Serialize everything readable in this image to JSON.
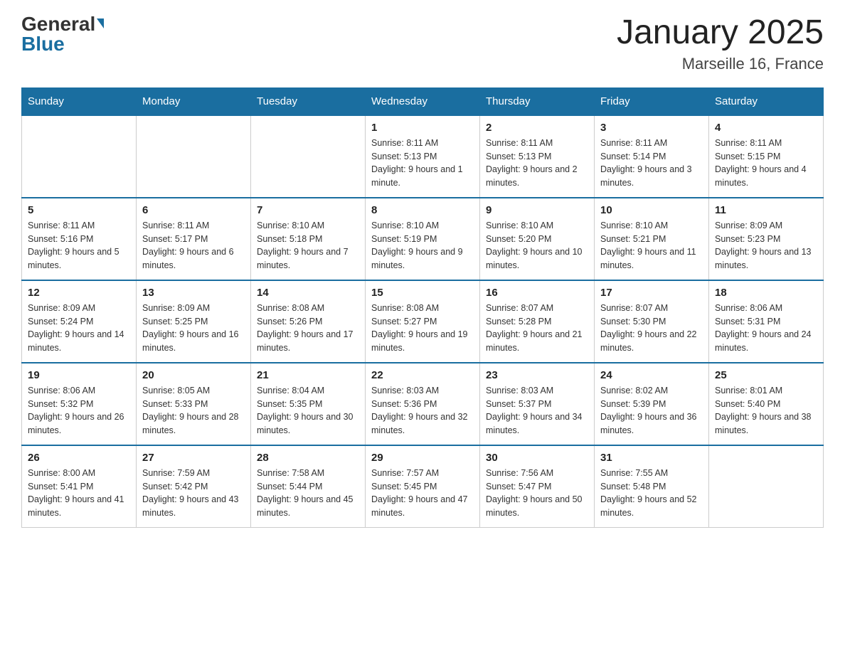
{
  "header": {
    "logo_general": "General",
    "logo_blue": "Blue",
    "month_title": "January 2025",
    "location": "Marseille 16, France"
  },
  "days_of_week": [
    "Sunday",
    "Monday",
    "Tuesday",
    "Wednesday",
    "Thursday",
    "Friday",
    "Saturday"
  ],
  "weeks": [
    [
      {
        "day": "",
        "info": ""
      },
      {
        "day": "",
        "info": ""
      },
      {
        "day": "",
        "info": ""
      },
      {
        "day": "1",
        "info": "Sunrise: 8:11 AM\nSunset: 5:13 PM\nDaylight: 9 hours and 1 minute."
      },
      {
        "day": "2",
        "info": "Sunrise: 8:11 AM\nSunset: 5:13 PM\nDaylight: 9 hours and 2 minutes."
      },
      {
        "day": "3",
        "info": "Sunrise: 8:11 AM\nSunset: 5:14 PM\nDaylight: 9 hours and 3 minutes."
      },
      {
        "day": "4",
        "info": "Sunrise: 8:11 AM\nSunset: 5:15 PM\nDaylight: 9 hours and 4 minutes."
      }
    ],
    [
      {
        "day": "5",
        "info": "Sunrise: 8:11 AM\nSunset: 5:16 PM\nDaylight: 9 hours and 5 minutes."
      },
      {
        "day": "6",
        "info": "Sunrise: 8:11 AM\nSunset: 5:17 PM\nDaylight: 9 hours and 6 minutes."
      },
      {
        "day": "7",
        "info": "Sunrise: 8:10 AM\nSunset: 5:18 PM\nDaylight: 9 hours and 7 minutes."
      },
      {
        "day": "8",
        "info": "Sunrise: 8:10 AM\nSunset: 5:19 PM\nDaylight: 9 hours and 9 minutes."
      },
      {
        "day": "9",
        "info": "Sunrise: 8:10 AM\nSunset: 5:20 PM\nDaylight: 9 hours and 10 minutes."
      },
      {
        "day": "10",
        "info": "Sunrise: 8:10 AM\nSunset: 5:21 PM\nDaylight: 9 hours and 11 minutes."
      },
      {
        "day": "11",
        "info": "Sunrise: 8:09 AM\nSunset: 5:23 PM\nDaylight: 9 hours and 13 minutes."
      }
    ],
    [
      {
        "day": "12",
        "info": "Sunrise: 8:09 AM\nSunset: 5:24 PM\nDaylight: 9 hours and 14 minutes."
      },
      {
        "day": "13",
        "info": "Sunrise: 8:09 AM\nSunset: 5:25 PM\nDaylight: 9 hours and 16 minutes."
      },
      {
        "day": "14",
        "info": "Sunrise: 8:08 AM\nSunset: 5:26 PM\nDaylight: 9 hours and 17 minutes."
      },
      {
        "day": "15",
        "info": "Sunrise: 8:08 AM\nSunset: 5:27 PM\nDaylight: 9 hours and 19 minutes."
      },
      {
        "day": "16",
        "info": "Sunrise: 8:07 AM\nSunset: 5:28 PM\nDaylight: 9 hours and 21 minutes."
      },
      {
        "day": "17",
        "info": "Sunrise: 8:07 AM\nSunset: 5:30 PM\nDaylight: 9 hours and 22 minutes."
      },
      {
        "day": "18",
        "info": "Sunrise: 8:06 AM\nSunset: 5:31 PM\nDaylight: 9 hours and 24 minutes."
      }
    ],
    [
      {
        "day": "19",
        "info": "Sunrise: 8:06 AM\nSunset: 5:32 PM\nDaylight: 9 hours and 26 minutes."
      },
      {
        "day": "20",
        "info": "Sunrise: 8:05 AM\nSunset: 5:33 PM\nDaylight: 9 hours and 28 minutes."
      },
      {
        "day": "21",
        "info": "Sunrise: 8:04 AM\nSunset: 5:35 PM\nDaylight: 9 hours and 30 minutes."
      },
      {
        "day": "22",
        "info": "Sunrise: 8:03 AM\nSunset: 5:36 PM\nDaylight: 9 hours and 32 minutes."
      },
      {
        "day": "23",
        "info": "Sunrise: 8:03 AM\nSunset: 5:37 PM\nDaylight: 9 hours and 34 minutes."
      },
      {
        "day": "24",
        "info": "Sunrise: 8:02 AM\nSunset: 5:39 PM\nDaylight: 9 hours and 36 minutes."
      },
      {
        "day": "25",
        "info": "Sunrise: 8:01 AM\nSunset: 5:40 PM\nDaylight: 9 hours and 38 minutes."
      }
    ],
    [
      {
        "day": "26",
        "info": "Sunrise: 8:00 AM\nSunset: 5:41 PM\nDaylight: 9 hours and 41 minutes."
      },
      {
        "day": "27",
        "info": "Sunrise: 7:59 AM\nSunset: 5:42 PM\nDaylight: 9 hours and 43 minutes."
      },
      {
        "day": "28",
        "info": "Sunrise: 7:58 AM\nSunset: 5:44 PM\nDaylight: 9 hours and 45 minutes."
      },
      {
        "day": "29",
        "info": "Sunrise: 7:57 AM\nSunset: 5:45 PM\nDaylight: 9 hours and 47 minutes."
      },
      {
        "day": "30",
        "info": "Sunrise: 7:56 AM\nSunset: 5:47 PM\nDaylight: 9 hours and 50 minutes."
      },
      {
        "day": "31",
        "info": "Sunrise: 7:55 AM\nSunset: 5:48 PM\nDaylight: 9 hours and 52 minutes."
      },
      {
        "day": "",
        "info": ""
      }
    ]
  ]
}
